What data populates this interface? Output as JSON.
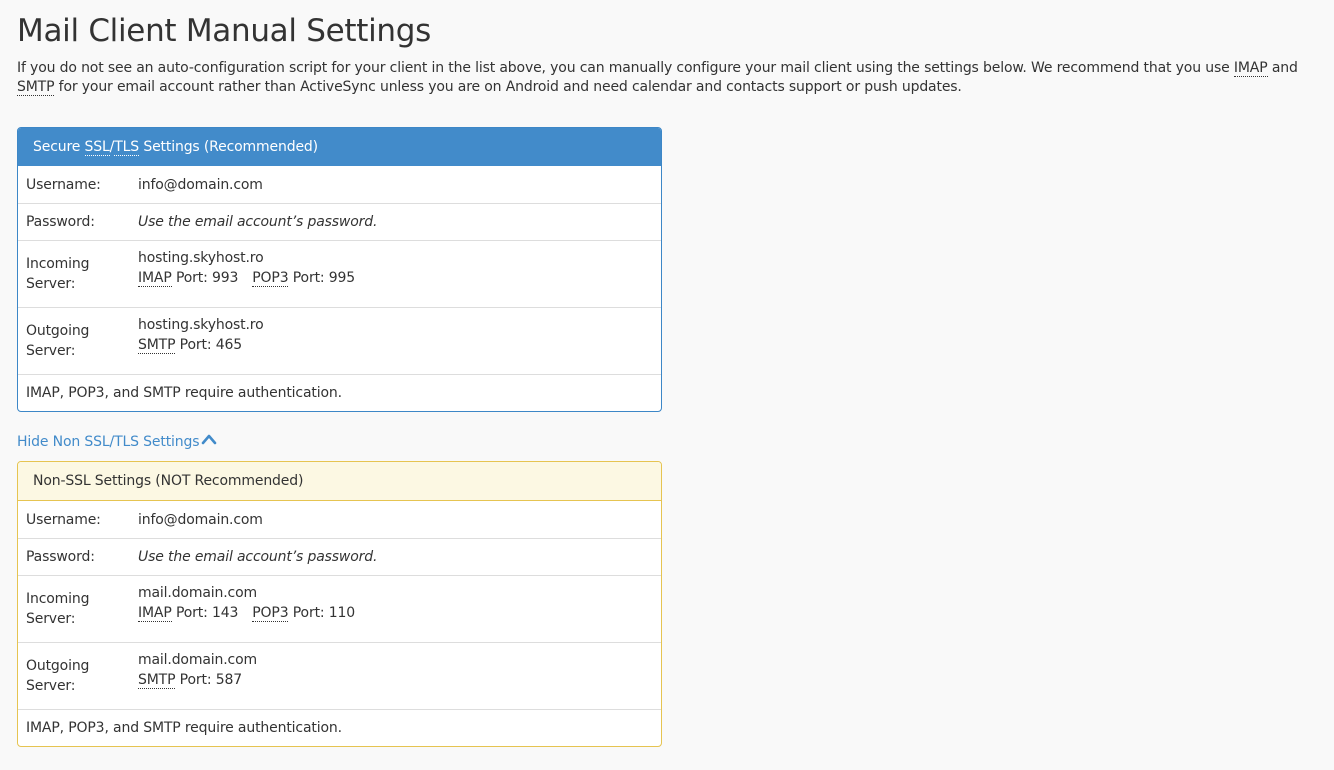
{
  "page": {
    "title": "Mail Client Manual Settings",
    "intro_part1": "If you do not see an auto-configuration script for your client in the list above, you can manually configure your mail client using the settings below. We recommend that you use ",
    "intro_abbr1": "IMAP",
    "intro_part2": " and ",
    "intro_abbr2": "SMTP",
    "intro_part3": " for your email account rather than ActiveSync unless you are on Android and need calendar and contacts support or push updates."
  },
  "secure": {
    "heading_prefix": "Secure ",
    "heading_abbr1": "SSL",
    "heading_slash": "/",
    "heading_abbr2": "TLS",
    "heading_suffix": " Settings (Recommended)",
    "username_label": "Username:",
    "username_value": "info@domain.com",
    "password_label": "Password:",
    "password_value": "Use the email account’s password.",
    "incoming_label": "Incoming Server:",
    "incoming_host": "hosting.skyhost.ro",
    "imap_abbr": "IMAP",
    "imap_port": " Port: 993",
    "pop3_abbr": "POP3",
    "pop3_port": " Port: 995",
    "outgoing_label": "Outgoing Server:",
    "outgoing_host": "hosting.skyhost.ro",
    "smtp_abbr": "SMTP",
    "smtp_port": " Port: 465",
    "footer": "IMAP, POP3, and SMTP require authentication."
  },
  "toggle": {
    "label": "Hide Non SSL/TLS Settings",
    "icon": "chevron-up-icon"
  },
  "nonssl": {
    "heading": "Non-SSL Settings (NOT Recommended)",
    "username_label": "Username:",
    "username_value": "info@domain.com",
    "password_label": "Password:",
    "password_value": "Use the email account’s password.",
    "incoming_label": "Incoming Server:",
    "incoming_host": "mail.domain.com",
    "imap_abbr": "IMAP",
    "imap_port": " Port: 143",
    "pop3_abbr": "POP3",
    "pop3_port": " Port: 110",
    "outgoing_label": "Outgoing Server:",
    "outgoing_host": "mail.domain.com",
    "smtp_abbr": "SMTP",
    "smtp_port": " Port: 587",
    "footer": "IMAP, POP3, and SMTP require authentication."
  },
  "colors": {
    "primary": "#428bca",
    "warning_bg": "#fcf8e3",
    "warning_border": "#e6c451",
    "text": "#333333",
    "background": "#f9f9f9"
  }
}
